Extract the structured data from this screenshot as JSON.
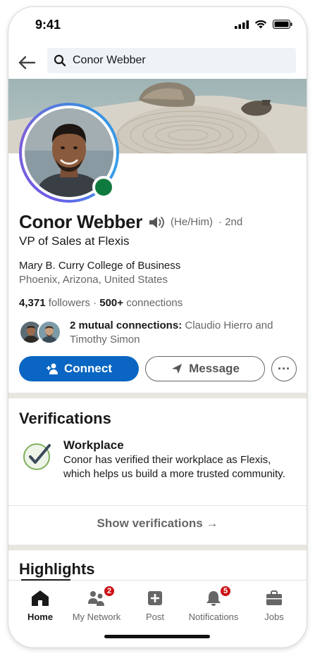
{
  "status_bar": {
    "time": "9:41"
  },
  "search": {
    "value": "Conor Webber"
  },
  "profile": {
    "name": "Conor Webber",
    "pronouns": "(He/Him)",
    "degree": "· 2nd",
    "headline": "VP of Sales at Flexis",
    "school": "Mary B. Curry College of Business",
    "location": "Phoenix, Arizona, United States",
    "followers_count": "4,371",
    "followers_label": "followers",
    "connections_count": "500+",
    "connections_label": "connections",
    "mutual_bold": "2 mutual connections:",
    "mutual_names": "Claudio Hierro and Timothy Simon"
  },
  "actions": {
    "connect_label": "Connect",
    "message_label": "Message",
    "more_label": "···"
  },
  "verifications": {
    "title": "Verifications",
    "item_title": "Workplace",
    "item_desc": "Conor has verified their workplace as Flexis, which helps us build a more trusted community.",
    "show_label": "Show verifications →"
  },
  "highlights": {
    "title": "Highlights"
  },
  "tabs": [
    {
      "label": "Home",
      "icon": "home-icon",
      "active": true
    },
    {
      "label": "My Network",
      "icon": "network-icon",
      "badge": "2"
    },
    {
      "label": "Post",
      "icon": "post-icon"
    },
    {
      "label": "Notifications",
      "icon": "bell-icon",
      "badge": "5"
    },
    {
      "label": "Jobs",
      "icon": "briefcase-icon"
    }
  ],
  "colors": {
    "primary": "#0a66c2",
    "online": "#0f7a3d",
    "badge": "#cc1016",
    "verified": "#5f9b3e"
  }
}
